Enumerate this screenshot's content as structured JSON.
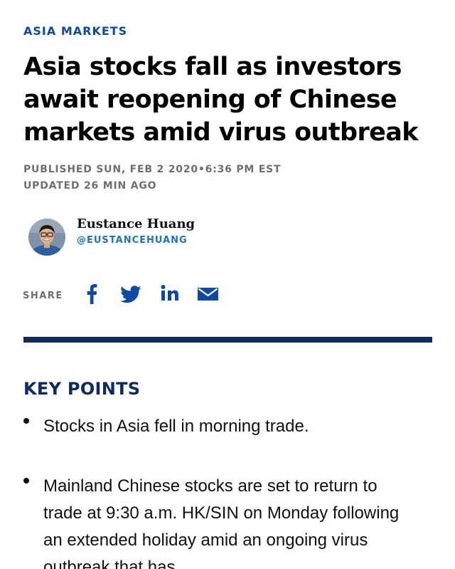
{
  "article": {
    "section": "ASIA MARKETS",
    "headline": "Asia stocks fall as investors await reopening of Chinese markets amid virus outbreak",
    "published": "PUBLISHED SUN, FEB 2 2020•6:36 PM EST",
    "updated": "UPDATED 26 MIN AGO"
  },
  "author": {
    "name": "Eustance Huang",
    "handle": "@EUSTANCEHUANG"
  },
  "share": {
    "label": "SHARE",
    "icons": [
      "facebook-icon",
      "twitter-icon",
      "linkedin-icon",
      "email-icon"
    ]
  },
  "key_points": {
    "title": "KEY POINTS",
    "items": [
      "Stocks in Asia fell in morning trade.",
      "Mainland Chinese stocks are set to return to trade at 9:30 a.m. HK/SIN on Monday following an extended holiday amid an ongoing virus outbreak that has"
    ]
  },
  "colors": {
    "accent_blue": "#0d4aa3",
    "navy": "#0e2a63",
    "handle_blue": "#1a73c9",
    "meta_gray": "#6f6f6f"
  }
}
